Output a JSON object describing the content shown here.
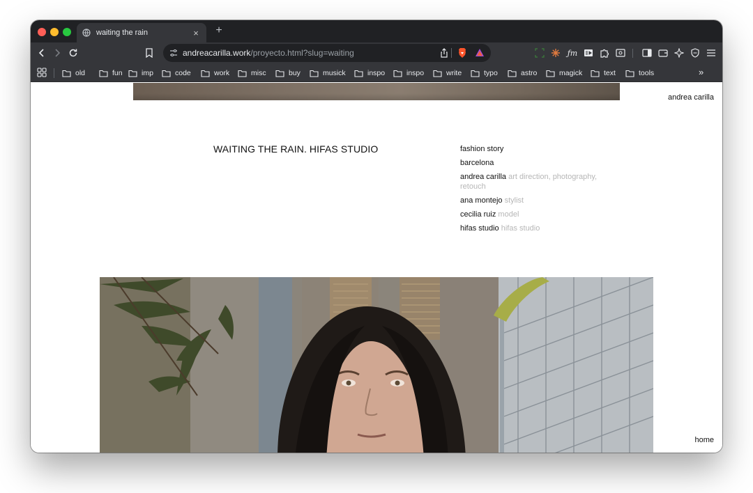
{
  "browser": {
    "tab_title": "waiting the rain",
    "tab_close": "×",
    "new_tab": "+",
    "url_host": "andreacarilla.work",
    "url_path": "/proyecto.html?slug=waiting",
    "bookmarks": [
      "old",
      "fun",
      "imp",
      "code",
      "work",
      "misc",
      "buy",
      "musick",
      "inspo",
      "inspo",
      "write",
      "typo",
      "astro",
      "magick",
      "text",
      "tools"
    ],
    "bookmarks_overflow": "»"
  },
  "page": {
    "site_name": "andrea carilla",
    "project_title": "WAITING THE RAIN. HIFAS STUDIO",
    "credits": [
      {
        "name": "fashion story",
        "role": ""
      },
      {
        "name": "barcelona",
        "role": ""
      },
      {
        "name": "andrea carilla",
        "role": "art direction, photography, retouch"
      },
      {
        "name": "ana montejo",
        "role": "stylist"
      },
      {
        "name": "cecilia ruiz",
        "role": "model"
      },
      {
        "name": "hifas studio",
        "role": "hifas studio"
      }
    ],
    "home_link": "home"
  },
  "colors": {
    "tabstrip": "#202124",
    "toolbar": "#35363a",
    "text_primary": "#111111",
    "text_role": "#b6b6b6"
  }
}
